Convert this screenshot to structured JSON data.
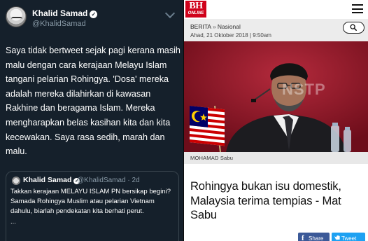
{
  "tweet": {
    "name": "Khalid Samad",
    "handle": "@KhalidSamad",
    "verified_glyph": "✓",
    "text": "Saya tidak bertweet sejak pagi kerana masih malu dengan cara kerajaan Melayu Islam  tangani pelarian Rohingya. 'Dosa' mereka adalah mereka dilahirkan di kawasan Rakhine dan beragama Islam. Mereka mengharapkan belas kasihan kita dan kita kecewakan. Saya rasa sedih, marah dan malu.",
    "quoted": {
      "name": "Khalid Samad",
      "handle": "@KhalidSamad · 2d",
      "text": "Takkan kerajaan MELAYU ISLAM PN bersikap begini? Samada Rohingya Muslim atau pelarian Vietnam dahulu, biarlah pendekatan kita berhati perut.",
      "ellipsis": "..."
    }
  },
  "news": {
    "logo_big": "BH",
    "logo_small": "ONLINE",
    "section": "BERITA",
    "separator": "»",
    "subsection": "Nasional",
    "date": "Ahad, 21 Oktober 2018 | 9:50am",
    "watermark": "NSTP",
    "photo_caption": "MOHAMAD Sabu",
    "headline": "Rohingya bukan isu domestik, Malaysia terima tempias - Mat Sabu",
    "share_icon": "f",
    "share_label": "Share",
    "tweet_label": "Tweet"
  },
  "icons": {
    "avatar": "avatar-icon",
    "verified": "verified-badge-icon",
    "caret": "chevron-down-icon",
    "menu": "hamburger-menu-icon",
    "search": "search-icon",
    "facebook": "facebook-icon",
    "twitter": "twitter-bird-icon"
  },
  "colors": {
    "tweet_bg": "#15202b",
    "tweet_secondary": "#8899a6",
    "bh_red": "#d0021b",
    "facebook": "#3b5998",
    "twitter": "#1da1f2"
  }
}
